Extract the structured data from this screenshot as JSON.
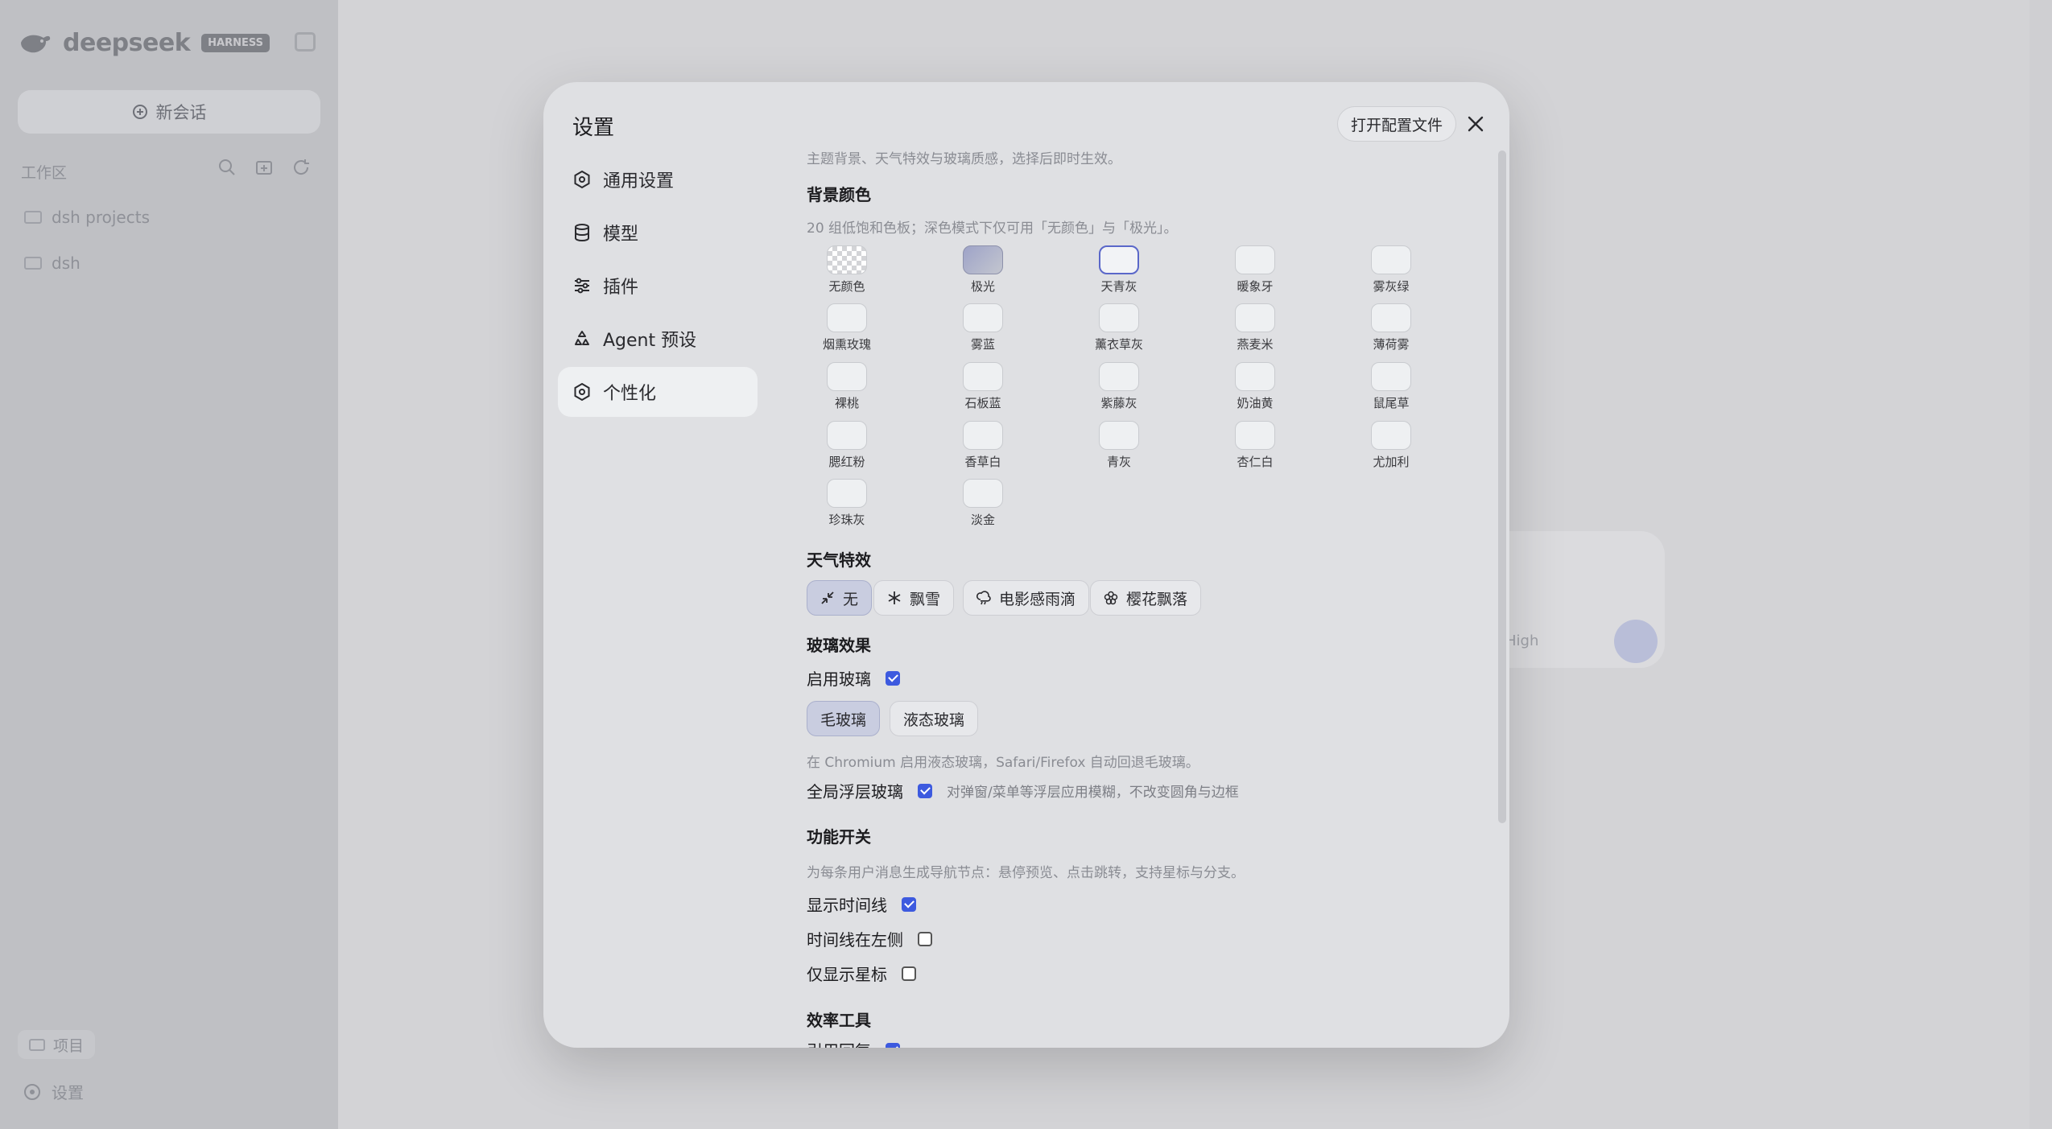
{
  "app": {
    "brand": "deepseek",
    "badge": "HARNESS",
    "new_chat": "新会话",
    "workspace_label": "工作区",
    "folders": [
      "dsh projects",
      "dsh"
    ],
    "projects": "项目",
    "settings": "设置",
    "effort": "High"
  },
  "modal": {
    "title": "设置",
    "open_config": "打开配置文件",
    "nav": [
      {
        "label": "通用设置",
        "icon": "gear-icon",
        "active": false
      },
      {
        "label": "模型",
        "icon": "database-icon",
        "active": false
      },
      {
        "label": "插件",
        "icon": "sliders-icon",
        "active": false
      },
      {
        "label": "Agent 预设",
        "icon": "recycle-icon",
        "active": false
      },
      {
        "label": "个性化",
        "icon": "gear-icon",
        "active": true
      }
    ]
  },
  "personalization": {
    "intro": "主题背景、天气特效与玻璃质感，选择后即时生效。",
    "bg": {
      "title": "背景颜色",
      "desc": "20 组低饱和色板；深色模式下仅可用「无颜色」与「极光」。",
      "swatches": [
        {
          "name": "无颜色",
          "style": "checker"
        },
        {
          "name": "极光",
          "style": "aurora"
        },
        {
          "name": "天青灰",
          "style": "selected"
        },
        {
          "name": "暖象牙",
          "style": "plain"
        },
        {
          "name": "雾灰绿",
          "style": "plain"
        },
        {
          "name": "烟熏玫瑰",
          "style": "plain"
        },
        {
          "name": "雾蓝",
          "style": "plain"
        },
        {
          "name": "薰衣草灰",
          "style": "plain"
        },
        {
          "name": "燕麦米",
          "style": "plain"
        },
        {
          "name": "薄荷雾",
          "style": "plain"
        },
        {
          "name": "裸桃",
          "style": "plain"
        },
        {
          "name": "石板蓝",
          "style": "plain"
        },
        {
          "name": "紫藤灰",
          "style": "plain"
        },
        {
          "name": "奶油黄",
          "style": "plain"
        },
        {
          "name": "鼠尾草",
          "style": "plain"
        },
        {
          "name": "腮红粉",
          "style": "plain"
        },
        {
          "name": "香草白",
          "style": "plain"
        },
        {
          "name": "青灰",
          "style": "plain"
        },
        {
          "name": "杏仁白",
          "style": "plain"
        },
        {
          "name": "尤加利",
          "style": "plain"
        },
        {
          "name": "珍珠灰",
          "style": "plain"
        },
        {
          "name": "淡金",
          "style": "plain"
        }
      ]
    },
    "weather": {
      "title": "天气特效",
      "options": [
        {
          "label": "无",
          "icon": "minimize-icon",
          "active": true
        },
        {
          "label": "飘雪",
          "icon": "snowflake-icon",
          "active": false
        },
        {
          "label": "电影感雨滴",
          "icon": "cloud-rain-icon",
          "active": false
        },
        {
          "label": "樱花飘落",
          "icon": "flower-icon",
          "active": false
        }
      ]
    },
    "glass": {
      "title": "玻璃效果",
      "enable_label": "启用玻璃",
      "enable_checked": true,
      "modes": [
        {
          "label": "毛玻璃",
          "active": true
        },
        {
          "label": "液态玻璃",
          "active": false
        }
      ],
      "mode_note": "在 Chromium 启用液态玻璃，Safari/Firefox 自动回退毛玻璃。",
      "global_label": "全局浮层玻璃",
      "global_checked": true,
      "global_hint": "对弹窗/菜单等浮层应用模糊，不改变圆角与边框"
    },
    "features": {
      "title": "功能开关",
      "desc": "为每条用户消息生成导航节点：悬停预览、点击跳转，支持星标与分支。",
      "toggles": [
        {
          "label": "显示时间线",
          "checked": true
        },
        {
          "label": "时间线在左侧",
          "checked": false
        },
        {
          "label": "仅显示星标",
          "checked": false
        }
      ]
    },
    "efficiency": {
      "title": "效率工具",
      "first_label": "引用回复",
      "first_checked": true
    }
  }
}
